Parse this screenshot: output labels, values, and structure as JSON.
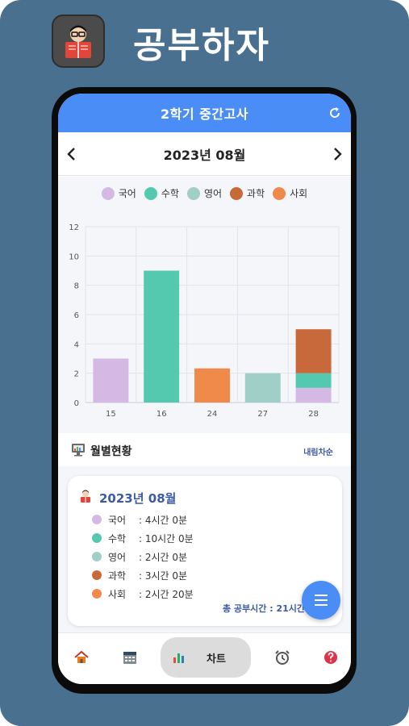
{
  "app": {
    "name": "공부하자"
  },
  "header": {
    "title": "2학기 중간고사"
  },
  "month_nav": {
    "label": "2023년 08월"
  },
  "legend": [
    {
      "label": "국어",
      "color": "#d4b9e4"
    },
    {
      "label": "수학",
      "color": "#55c9b0"
    },
    {
      "label": "영어",
      "color": "#9fcfc6"
    },
    {
      "label": "과학",
      "color": "#c8693c"
    },
    {
      "label": "사회",
      "color": "#f08a4b"
    }
  ],
  "chart_data": {
    "type": "bar",
    "stacked": true,
    "categories": [
      "15",
      "16",
      "24",
      "27",
      "28"
    ],
    "series": [
      {
        "name": "국어",
        "color": "#d4b9e4",
        "values": [
          3,
          0,
          0,
          0,
          1
        ]
      },
      {
        "name": "수학",
        "color": "#55c9b0",
        "values": [
          0,
          9,
          0,
          0,
          1
        ]
      },
      {
        "name": "영어",
        "color": "#9fcfc6",
        "values": [
          0,
          0,
          0,
          2,
          0
        ]
      },
      {
        "name": "과학",
        "color": "#c8693c",
        "values": [
          0,
          0,
          0,
          0,
          3
        ]
      },
      {
        "name": "사회",
        "color": "#f08a4b",
        "values": [
          0,
          0,
          2.33,
          0,
          0
        ]
      }
    ],
    "ylim": [
      0,
      12
    ],
    "yticks": [
      "0",
      "2",
      "4",
      "6",
      "8",
      "10",
      "12"
    ],
    "grid": true
  },
  "section": {
    "title": "월별현황",
    "sort_label": "내림차순"
  },
  "summary": {
    "title": "2023년 08월",
    "rows": [
      {
        "name": "국어",
        "time": ": 4시간 0분",
        "color": "#d4b9e4"
      },
      {
        "name": "수학",
        "time": ": 10시간 0분",
        "color": "#55c9b0"
      },
      {
        "name": "영어",
        "time": ": 2시간 0분",
        "color": "#9fcfc6"
      },
      {
        "name": "과학",
        "time": ": 3시간 0분",
        "color": "#c8693c"
      },
      {
        "name": "사회",
        "time": ": 2시간 20분",
        "color": "#f08a4b"
      }
    ],
    "total": "총 공부시간 : 21시간"
  },
  "bottom_nav": {
    "active_label": "차트",
    "items": [
      "home-icon",
      "calendar-icon",
      "chart-icon",
      "alarm-icon",
      "help-icon"
    ]
  }
}
